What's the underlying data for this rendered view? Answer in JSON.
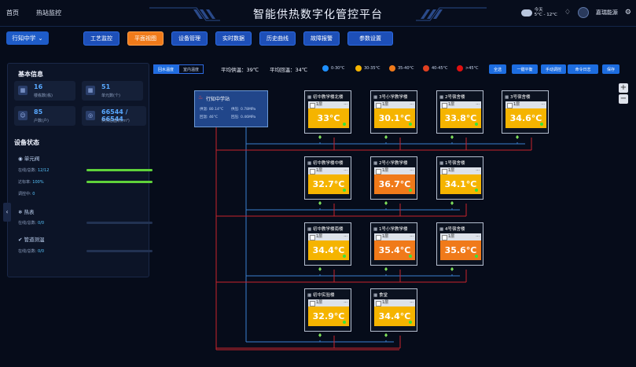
{
  "topnav": {
    "home": "首页",
    "station": "热站监控"
  },
  "title": "智能供热数字化管控平台",
  "weather": {
    "day": "今天",
    "temp": "5°C - 12°C"
  },
  "user": {
    "name": "嘉瑞能源"
  },
  "school_select": "行知中学",
  "tabs": [
    "工艺监控",
    "平面视图",
    "设备管理",
    "实时数据",
    "历史曲线",
    "故障报警",
    "参数设置"
  ],
  "active_tab": 1,
  "basic": {
    "title": "基本信息",
    "stats": [
      {
        "value": "16",
        "label": "楼栋数(栋)"
      },
      {
        "value": "51",
        "label": "单元数(个)"
      },
      {
        "value": "85",
        "label": "户数(户)"
      },
      {
        "value": "66544 / 66544",
        "label": "供热总面积(m²)"
      }
    ]
  },
  "device": {
    "title": "设备状态",
    "unit_valve": {
      "title": "单元阀",
      "online_label": "在线/总数:",
      "online": "12/12",
      "rate_label": "达标率:",
      "rate": "100%",
      "adjust_label": "调控中:",
      "adjust": "0",
      "online_pct": 100,
      "rate_pct": 100
    },
    "meter": {
      "title": "热表",
      "online_label": "在线/总数:",
      "online": "0/0",
      "online_pct": 0
    },
    "pipe": {
      "title": "管道测温",
      "online_label": "在线/总数:",
      "online": "0/0",
      "online_pct": 0
    }
  },
  "toggle": [
    "回水温度",
    "室内温度"
  ],
  "avg_supply": "平均供温：39℃",
  "avg_return": "平均回温：34℃",
  "legend": [
    {
      "label": "0-30°C",
      "color": "#1e90ff"
    },
    {
      "label": "30-35°C",
      "color": "#f5b400"
    },
    {
      "label": "35-40°C",
      "color": "#f07a1a"
    },
    {
      "label": "40-45°C",
      "color": "#e04020"
    },
    {
      "label": ">45°C",
      "color": "#e01010"
    }
  ],
  "right_buttons": [
    "全选",
    "一键平衡",
    "手动调控",
    "命令日志",
    "保存"
  ],
  "zoom": {
    "in": "+",
    "out": "−"
  },
  "station": {
    "name": "行知中学站",
    "supply_t": "供温: 80.14°C",
    "supply_p": "供压: 0.78MPa",
    "return_t": "回温: 46°C",
    "return_p": "回压: 0.46MPa"
  },
  "buildings": [
    {
      "name": "初中教学楼北楼",
      "floor": "1层",
      "temp": "33°C",
      "color": "#f5b400"
    },
    {
      "name": "3号小学教学楼",
      "floor": "1层",
      "temp": "30.1°C",
      "color": "#f5b400"
    },
    {
      "name": "2号宿舍楼",
      "floor": "1层",
      "temp": "33.8°C",
      "color": "#f5b400"
    },
    {
      "name": "3号宿舍楼",
      "floor": "1层",
      "temp": "34.6°C",
      "color": "#f5b400"
    },
    {
      "name": "初中教学楼中楼",
      "floor": "1层",
      "temp": "32.7°C",
      "color": "#f5b400"
    },
    {
      "name": "2号小学教学楼",
      "floor": "1层",
      "temp": "36.7°C",
      "color": "#f07a1a"
    },
    {
      "name": "1号宿舍楼",
      "floor": "1层",
      "temp": "34.1°C",
      "color": "#f5b400"
    },
    {
      "name": "初中教学楼南楼",
      "floor": "1层",
      "temp": "34.4°C",
      "color": "#f5b400"
    },
    {
      "name": "1号小学教学楼",
      "floor": "1层",
      "temp": "35.4°C",
      "color": "#f07a1a"
    },
    {
      "name": "4号宿舍楼",
      "floor": "1层",
      "temp": "35.6°C",
      "color": "#f07a1a"
    },
    {
      "name": "初中实验楼",
      "floor": "1层",
      "temp": "32.9°C",
      "color": "#f5b400"
    },
    {
      "name": "食堂",
      "floor": "1层",
      "temp": "34.4°C",
      "color": "#f5b400"
    }
  ]
}
